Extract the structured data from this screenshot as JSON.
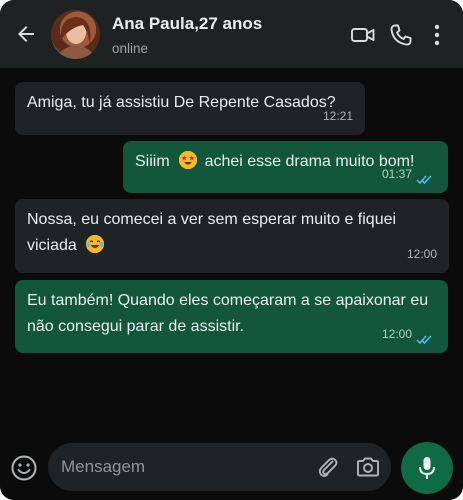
{
  "header": {
    "contact_name": "Ana Paula,27 anos",
    "status": "online"
  },
  "messages": [
    {
      "direction": "incoming",
      "text": "Amiga, tu já assistiu De Repente Casados?",
      "time": "12:21"
    },
    {
      "direction": "outgoing",
      "text_before_emoji": "Siiim",
      "emoji": "star-struck",
      "text_after_emoji": "achei esse drama muito bom!",
      "time": "01:37",
      "read": true
    },
    {
      "direction": "incoming",
      "text": "Nossa, eu comecei a ver sem esperar muito e fiquei viciada",
      "emoji": "tears-of-joy",
      "time": "12:00"
    },
    {
      "direction": "outgoing",
      "text": "Eu também! Quando eles começaram a se apaixonar eu não consegui parar de assistir.",
      "time": "12:00",
      "read": true
    }
  ],
  "composer": {
    "placeholder": "Mensagem"
  },
  "colors": {
    "incoming_bubble": "#202325",
    "outgoing_bubble": "#12573b",
    "read_ticks": "#53bdeb",
    "mic_button": "#0f6b46"
  },
  "icons": [
    "back-arrow-icon",
    "video-call-icon",
    "phone-icon",
    "more-vert-icon",
    "emoji-icon",
    "attach-icon",
    "camera-icon",
    "mic-icon"
  ]
}
